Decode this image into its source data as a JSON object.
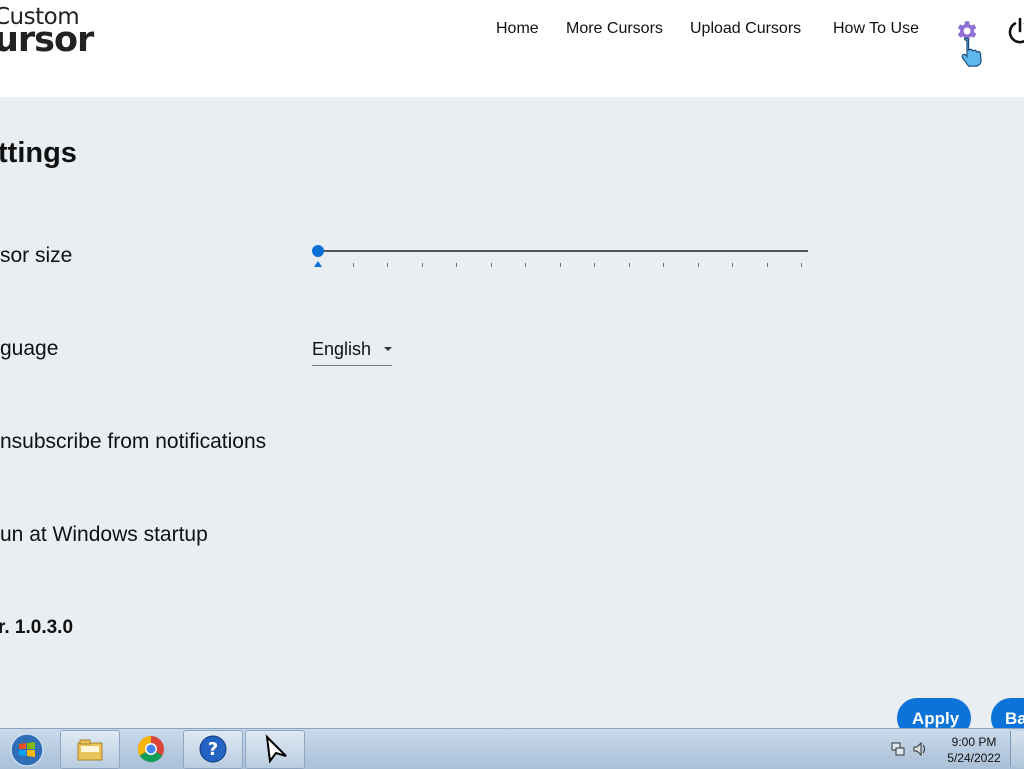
{
  "header": {
    "logo_line1": "Custom",
    "logo_line2": "ursor",
    "nav": [
      "Home",
      "More Cursors",
      "Upload Cursors",
      "How To Use"
    ]
  },
  "settings": {
    "title": "ttings",
    "cursor_size_label": "sor size",
    "cursor_size_value": 0,
    "language_label": "guage",
    "language_value": "English",
    "unsubscribe_label": "nsubscribe from notifications",
    "run_startup_label": "un at Windows startup",
    "version": "r. 1.0.3.0"
  },
  "buttons": {
    "apply": "Apply",
    "back": "Ba"
  },
  "taskbar": {
    "time": "9:00 PM",
    "date": "5/24/2022"
  },
  "colors": {
    "accent": "#0b73da",
    "background": "#e8eef2",
    "gear": "#8e6fd6"
  },
  "icons": [
    "logo",
    "settings-gear-icon",
    "hand-pointer-icon",
    "power-icon",
    "windows-start-icon",
    "folder-icon",
    "chrome-icon",
    "help-icon",
    "cursor-app-icon",
    "network-icon",
    "speaker-icon"
  ]
}
